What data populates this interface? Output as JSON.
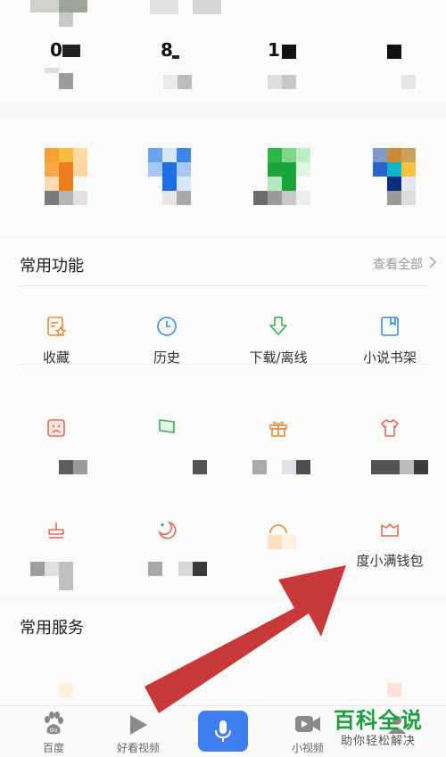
{
  "stats": [
    {
      "value": "0"
    },
    {
      "value": "8"
    },
    {
      "value": "1"
    },
    {
      "value": ""
    }
  ],
  "common_functions": {
    "title": "常用功能",
    "view_all": "查看全部",
    "items": [
      {
        "label": "收藏",
        "icon": "favorites-icon"
      },
      {
        "label": "历史",
        "icon": "clock-icon"
      },
      {
        "label": "下载/离线",
        "icon": "download-icon"
      },
      {
        "label": "小说书架",
        "icon": "bookshelf-icon"
      },
      {
        "label": "",
        "icon": "face-card-icon"
      },
      {
        "label": "",
        "icon": "flag-icon"
      },
      {
        "label": "",
        "icon": "gift-icon"
      },
      {
        "label": "",
        "icon": "shirt-icon"
      },
      {
        "label": "",
        "icon": "stamp-icon"
      },
      {
        "label": "",
        "icon": "moon-star-icon"
      },
      {
        "label": "",
        "icon": "arc-icon"
      },
      {
        "label": "度小满钱包",
        "icon": "wallet-icon"
      }
    ]
  },
  "common_services": {
    "title": "常用服务"
  },
  "nav": {
    "items": [
      {
        "label": "百度",
        "icon": "paw-icon"
      },
      {
        "label": "好看视频",
        "icon": "play-icon"
      },
      {
        "label": "",
        "icon": "mic-icon"
      },
      {
        "label": "小视频",
        "icon": "video-camera-icon"
      },
      {
        "label": "",
        "icon": "profile-icon"
      }
    ]
  },
  "watermark": {
    "title": "百科全说",
    "subtitle": "助你轻松解决"
  },
  "colors": {
    "orange_icon": "#e98a3c",
    "blue_icon": "#3a8ee6",
    "green_icon": "#2fb35a",
    "red_icon": "#e36a5a",
    "mic_button": "#3f7ef0",
    "watermark_green": "#1a9f3b",
    "arrow_red": "#c8373a"
  }
}
